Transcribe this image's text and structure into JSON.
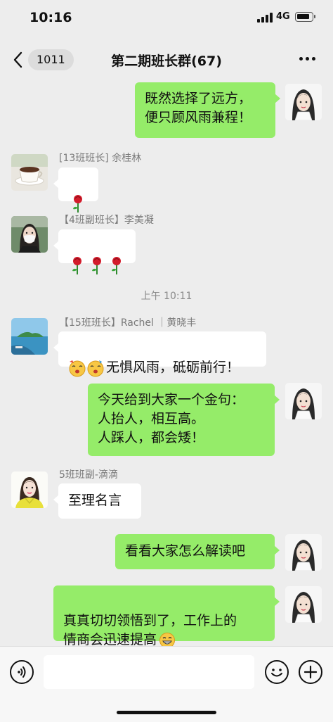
{
  "status_bar": {
    "time": "10:16",
    "network": "4G"
  },
  "nav": {
    "back_count": "1011",
    "title": "第二期班长群(67)"
  },
  "messages": [
    {
      "side": "self",
      "text": "既然选择了远方，\n便只顾风雨兼程！"
    },
    {
      "side": "other",
      "sender": "[13班班长] 余桂林",
      "content": "rose-emoji",
      "avatar": "coffee-cup-avatar"
    },
    {
      "side": "other",
      "sender": "【4班副班长】李美凝",
      "content": "three-roses-emoji",
      "avatar": "woman-masked-avatar"
    },
    {
      "timestamp": "上午 10:11"
    },
    {
      "side": "other",
      "sender": "【15班班长】Rachel ｜黄晓丰",
      "text": "无惧风雨，砥砺前行！",
      "emoji": "cheering-face-emoji",
      "avatar": "island-avatar"
    },
    {
      "side": "self",
      "text": "今天给到大家一个金句：\n人抬人，相互高。\n人踩人，都会矮！"
    },
    {
      "side": "other",
      "sender": "5班班副-滴滴",
      "text": "至理名言",
      "avatar": "girl-yellow-jacket-avatar"
    },
    {
      "side": "self",
      "text": "看看大家怎么解读吧"
    },
    {
      "side": "self",
      "text": "真真切切领悟到了，工作上的\n情商会迅速提高",
      "emoji": "grinning-face-emoji"
    }
  ],
  "input_bar": {
    "icons": [
      "voice-icon",
      "emoji-icon",
      "plus-icon"
    ]
  },
  "colors": {
    "self_bubble": "#95ec69",
    "other_bubble": "#ffffff",
    "background": "#ededed"
  }
}
